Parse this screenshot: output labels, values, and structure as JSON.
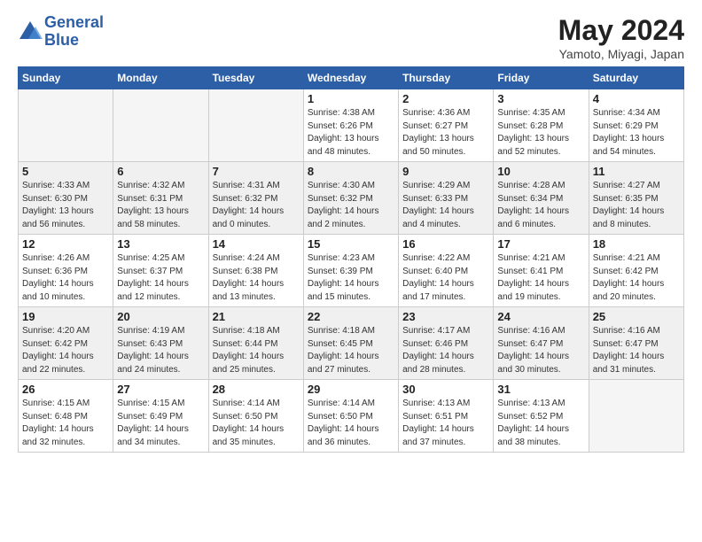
{
  "header": {
    "logo_line1": "General",
    "logo_line2": "Blue",
    "month_title": "May 2024",
    "subtitle": "Yamoto, Miyagi, Japan"
  },
  "weekdays": [
    "Sunday",
    "Monday",
    "Tuesday",
    "Wednesday",
    "Thursday",
    "Friday",
    "Saturday"
  ],
  "weeks": [
    [
      {
        "day": "",
        "info": ""
      },
      {
        "day": "",
        "info": ""
      },
      {
        "day": "",
        "info": ""
      },
      {
        "day": "1",
        "info": "Sunrise: 4:38 AM\nSunset: 6:26 PM\nDaylight: 13 hours\nand 48 minutes."
      },
      {
        "day": "2",
        "info": "Sunrise: 4:36 AM\nSunset: 6:27 PM\nDaylight: 13 hours\nand 50 minutes."
      },
      {
        "day": "3",
        "info": "Sunrise: 4:35 AM\nSunset: 6:28 PM\nDaylight: 13 hours\nand 52 minutes."
      },
      {
        "day": "4",
        "info": "Sunrise: 4:34 AM\nSunset: 6:29 PM\nDaylight: 13 hours\nand 54 minutes."
      }
    ],
    [
      {
        "day": "5",
        "info": "Sunrise: 4:33 AM\nSunset: 6:30 PM\nDaylight: 13 hours\nand 56 minutes."
      },
      {
        "day": "6",
        "info": "Sunrise: 4:32 AM\nSunset: 6:31 PM\nDaylight: 13 hours\nand 58 minutes."
      },
      {
        "day": "7",
        "info": "Sunrise: 4:31 AM\nSunset: 6:32 PM\nDaylight: 14 hours\nand 0 minutes."
      },
      {
        "day": "8",
        "info": "Sunrise: 4:30 AM\nSunset: 6:32 PM\nDaylight: 14 hours\nand 2 minutes."
      },
      {
        "day": "9",
        "info": "Sunrise: 4:29 AM\nSunset: 6:33 PM\nDaylight: 14 hours\nand 4 minutes."
      },
      {
        "day": "10",
        "info": "Sunrise: 4:28 AM\nSunset: 6:34 PM\nDaylight: 14 hours\nand 6 minutes."
      },
      {
        "day": "11",
        "info": "Sunrise: 4:27 AM\nSunset: 6:35 PM\nDaylight: 14 hours\nand 8 minutes."
      }
    ],
    [
      {
        "day": "12",
        "info": "Sunrise: 4:26 AM\nSunset: 6:36 PM\nDaylight: 14 hours\nand 10 minutes."
      },
      {
        "day": "13",
        "info": "Sunrise: 4:25 AM\nSunset: 6:37 PM\nDaylight: 14 hours\nand 12 minutes."
      },
      {
        "day": "14",
        "info": "Sunrise: 4:24 AM\nSunset: 6:38 PM\nDaylight: 14 hours\nand 13 minutes."
      },
      {
        "day": "15",
        "info": "Sunrise: 4:23 AM\nSunset: 6:39 PM\nDaylight: 14 hours\nand 15 minutes."
      },
      {
        "day": "16",
        "info": "Sunrise: 4:22 AM\nSunset: 6:40 PM\nDaylight: 14 hours\nand 17 minutes."
      },
      {
        "day": "17",
        "info": "Sunrise: 4:21 AM\nSunset: 6:41 PM\nDaylight: 14 hours\nand 19 minutes."
      },
      {
        "day": "18",
        "info": "Sunrise: 4:21 AM\nSunset: 6:42 PM\nDaylight: 14 hours\nand 20 minutes."
      }
    ],
    [
      {
        "day": "19",
        "info": "Sunrise: 4:20 AM\nSunset: 6:42 PM\nDaylight: 14 hours\nand 22 minutes."
      },
      {
        "day": "20",
        "info": "Sunrise: 4:19 AM\nSunset: 6:43 PM\nDaylight: 14 hours\nand 24 minutes."
      },
      {
        "day": "21",
        "info": "Sunrise: 4:18 AM\nSunset: 6:44 PM\nDaylight: 14 hours\nand 25 minutes."
      },
      {
        "day": "22",
        "info": "Sunrise: 4:18 AM\nSunset: 6:45 PM\nDaylight: 14 hours\nand 27 minutes."
      },
      {
        "day": "23",
        "info": "Sunrise: 4:17 AM\nSunset: 6:46 PM\nDaylight: 14 hours\nand 28 minutes."
      },
      {
        "day": "24",
        "info": "Sunrise: 4:16 AM\nSunset: 6:47 PM\nDaylight: 14 hours\nand 30 minutes."
      },
      {
        "day": "25",
        "info": "Sunrise: 4:16 AM\nSunset: 6:47 PM\nDaylight: 14 hours\nand 31 minutes."
      }
    ],
    [
      {
        "day": "26",
        "info": "Sunrise: 4:15 AM\nSunset: 6:48 PM\nDaylight: 14 hours\nand 32 minutes."
      },
      {
        "day": "27",
        "info": "Sunrise: 4:15 AM\nSunset: 6:49 PM\nDaylight: 14 hours\nand 34 minutes."
      },
      {
        "day": "28",
        "info": "Sunrise: 4:14 AM\nSunset: 6:50 PM\nDaylight: 14 hours\nand 35 minutes."
      },
      {
        "day": "29",
        "info": "Sunrise: 4:14 AM\nSunset: 6:50 PM\nDaylight: 14 hours\nand 36 minutes."
      },
      {
        "day": "30",
        "info": "Sunrise: 4:13 AM\nSunset: 6:51 PM\nDaylight: 14 hours\nand 37 minutes."
      },
      {
        "day": "31",
        "info": "Sunrise: 4:13 AM\nSunset: 6:52 PM\nDaylight: 14 hours\nand 38 minutes."
      },
      {
        "day": "",
        "info": ""
      }
    ]
  ]
}
